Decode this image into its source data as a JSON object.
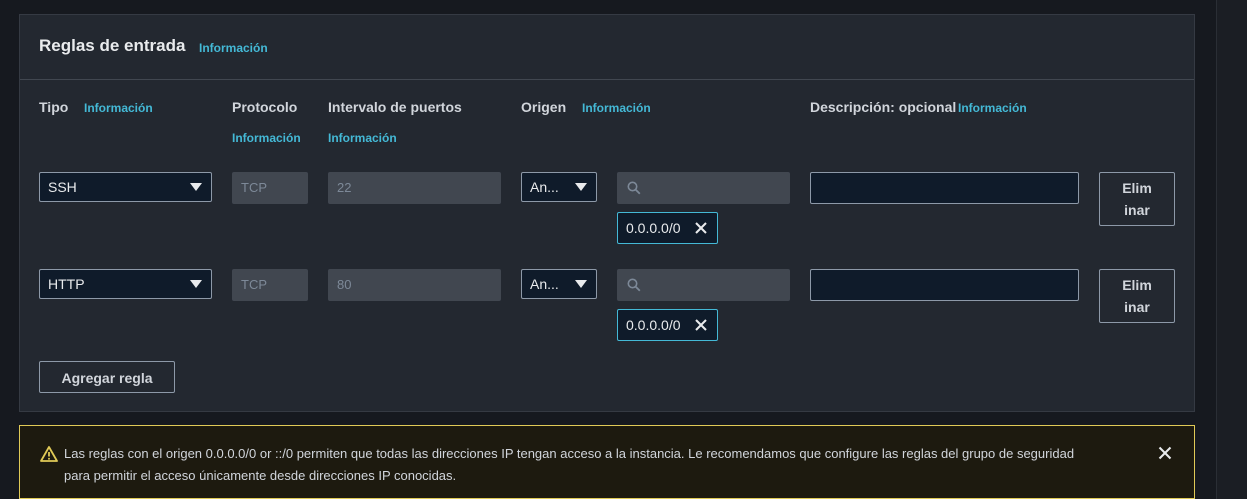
{
  "section": {
    "title": "Reglas de entrada",
    "info": "Información"
  },
  "columns": {
    "type": {
      "label": "Tipo",
      "info": "Información"
    },
    "protocol": {
      "label": "Protocolo",
      "info": "Información"
    },
    "port_range": {
      "label": "Intervalo de puertos",
      "info": "Información"
    },
    "source": {
      "label": "Origen",
      "info": "Información"
    },
    "description": {
      "label": "Descripción: opcional",
      "info": "Información"
    }
  },
  "rules": [
    {
      "type": "SSH",
      "protocol": "TCP",
      "port": "22",
      "source_select": "An...",
      "source_token": "0.0.0.0/0",
      "description": "",
      "delete_label": "Elim inar"
    },
    {
      "type": "HTTP",
      "protocol": "TCP",
      "port": "80",
      "source_select": "An...",
      "source_token": "0.0.0.0/0",
      "description": "",
      "delete_label": "Elim inar"
    }
  ],
  "add_rule_label": "Agregar regla",
  "warning": {
    "text": "Las reglas con el origen 0.0.0.0/0 or ::/0 permiten que todas las direcciones IP tengan acceso a la instancia. Le recomendamos que configure las reglas del grupo de seguridad para permitir el acceso únicamente desde direcciones IP conocidas.",
    "icon": "warning-icon",
    "close_icon": "close-icon"
  },
  "colors": {
    "accent": "#44b9d6",
    "panel_bg": "#232830",
    "warning_border": "#e0ca57"
  }
}
